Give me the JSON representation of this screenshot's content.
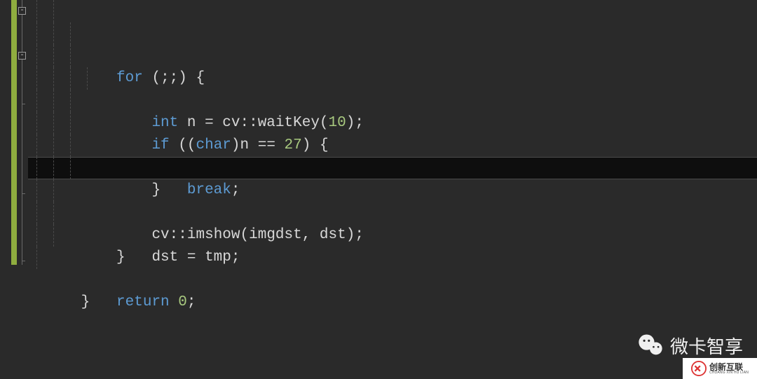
{
  "code": {
    "l1_kw": "for",
    "l1_rest": " (;;) {",
    "l2_type": "int",
    "l2_var": " n = cv",
    "l2_op": "::",
    "l2_fn": "waitKey",
    "l2_paren_o": "(",
    "l2_num": "10",
    "l2_end": ");",
    "l3_kw": "if",
    "l3_mid1": " ((",
    "l3_type": "char",
    "l3_mid2": ")n == ",
    "l3_num": "27",
    "l3_end": ") {",
    "l4_kw": "break",
    "l4_end": ";",
    "l5": "}",
    "l6": "",
    "l7_pre": "cv",
    "l7_op": "::",
    "l7_fn": "imshow",
    "l7_args": "(imgdst, dst);",
    "l8": "dst = tmp;",
    "l9": "}",
    "l10": "",
    "l11_kw": "return",
    "l11_sp": " ",
    "l11_num": "0",
    "l11_end": ";",
    "l12": "}"
  },
  "fold": {
    "minus": "-"
  },
  "watermark": {
    "wechat_text": "微卡智享"
  },
  "corner": {
    "cn": "创新互联",
    "en": "CHUANG XIN HU LIAN"
  }
}
